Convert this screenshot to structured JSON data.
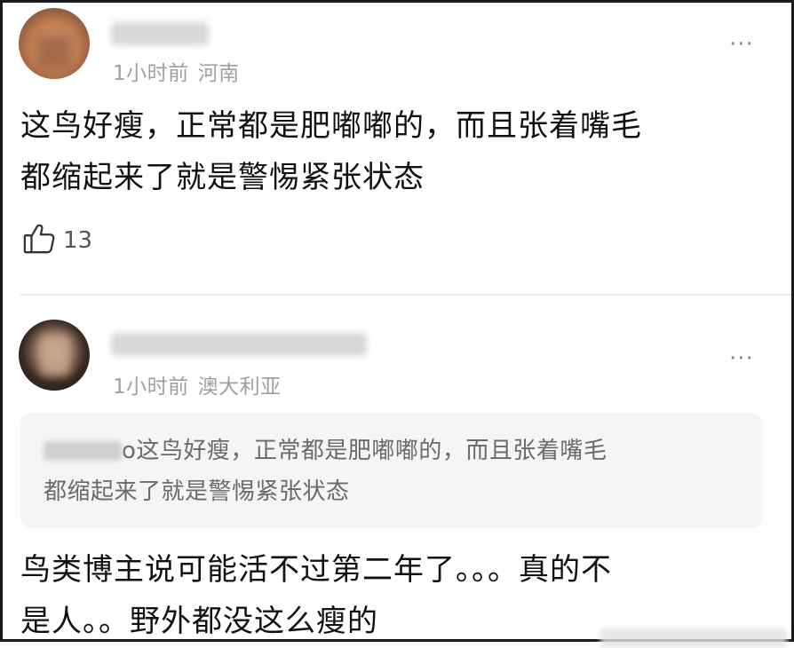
{
  "comments": [
    {
      "meta": {
        "time": "1小时前",
        "location": "河南"
      },
      "text_lines": [
        "这鸟好瘦，正常都是肥嘟嘟的，而且张着嘴毛",
        "都缩起来了就是警惕紧张状态"
      ],
      "likes": "13",
      "more_label": "···",
      "icon": "thumbs-up-icon"
    },
    {
      "meta": {
        "time": "1小时前",
        "location": "澳大利亚"
      },
      "quote": {
        "suffix": "o",
        "lines": [
          "这鸟好瘦，正常都是肥嘟嘟的，而且张着嘴毛",
          "都缩起来了就是警惕紧张状态"
        ]
      },
      "text_lines": [
        "鸟类博主说可能活不过第二年了。。。真的不",
        "是人。。野外都没这么瘦的"
      ],
      "more_label": "···"
    }
  ],
  "colors": {
    "text": "#111111",
    "meta": "#a0a0a0",
    "quote_bg": "#f5f5f5"
  }
}
